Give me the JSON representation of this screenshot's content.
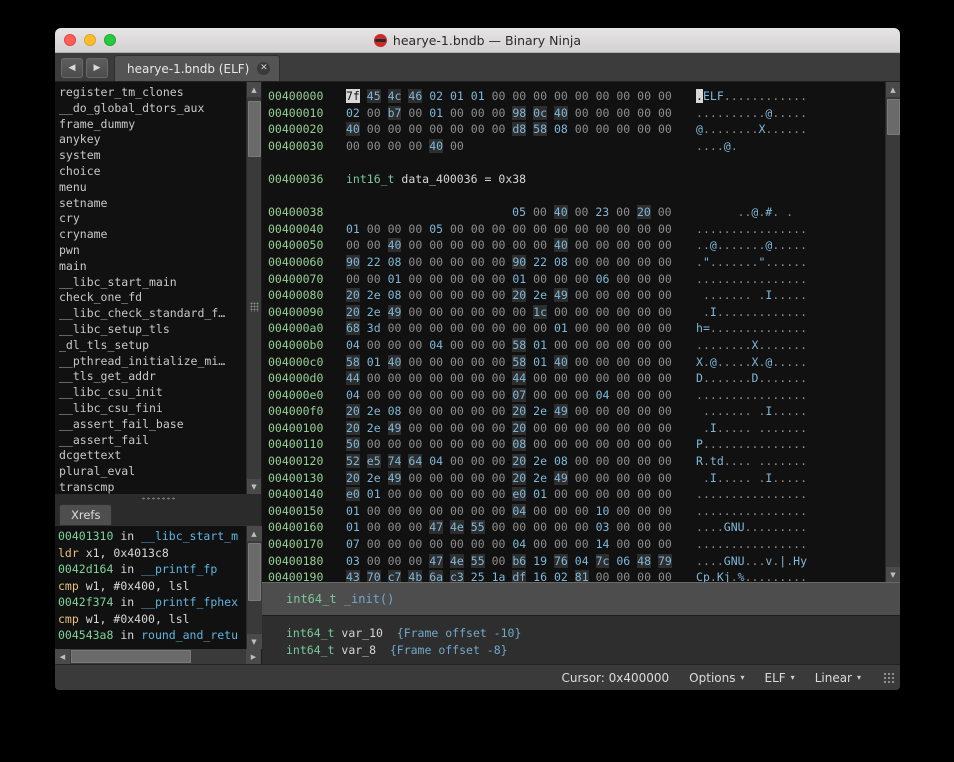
{
  "window": {
    "title": "hearye-1.bndb — Binary Ninja",
    "app_icon": "ninja-icon",
    "traffic": {
      "close": "close-button",
      "minimize": "minimize-button",
      "zoom": "zoom-button"
    }
  },
  "tabstrip": {
    "back_glyph": "◀",
    "forward_glyph": "▶",
    "tab_label": "hearye-1.bndb (ELF)",
    "close_glyph": "✕"
  },
  "sidebar": {
    "functions": [
      "register_tm_clones",
      "__do_global_dtors_aux",
      "frame_dummy",
      "anykey",
      "system",
      "choice",
      "menu",
      "setname",
      "cry",
      "cryname",
      "pwn",
      "main",
      "__libc_start_main",
      "check_one_fd",
      "__libc_check_standard_f…",
      "__libc_setup_tls",
      "_dl_tls_setup",
      "__pthread_initialize_mi…",
      "__tls_get_addr",
      "__libc_csu_init",
      "__libc_csu_fini",
      "__assert_fail_base",
      "__assert_fail",
      "dcgettext",
      "plural_eval",
      "transcmp"
    ]
  },
  "xrefs": {
    "tab_label": "Xrefs",
    "entries": [
      {
        "addr": "00401310",
        "in": "in",
        "func": "__libc_start_m",
        "mnem": "ldr",
        "ops": "x1, 0x4013c8"
      },
      {
        "addr": "0042d164",
        "in": "in",
        "func": "__printf_fp",
        "mnem": "cmp",
        "ops": "w1, #0x400, lsl"
      },
      {
        "addr": "0042f374",
        "in": "in",
        "func": "__printf_fphex",
        "mnem": "cmp",
        "ops": "w1, #0x400, lsl"
      },
      {
        "addr": "004543a8",
        "in": "in",
        "func": "round_and_retu",
        "mnem": "",
        "ops": ""
      }
    ]
  },
  "hex": {
    "rows": [
      {
        "addr": "00400000",
        "bytes": "7f 45 4c 46 02 01 01 00-00 00 00 00 00 00 00 00",
        "ascii": ".ELF............"
      },
      {
        "addr": "00400010",
        "bytes": "02 00 b7 00 01 00 00 00-98 0c 40 00 00 00 00 00",
        "ascii": "..........@....."
      },
      {
        "addr": "00400020",
        "bytes": "40 00 00 00 00 00 00 00-d8 58 08 00 00 00 00 00",
        "ascii": "@........X......"
      },
      {
        "addr": "00400030",
        "bytes": "00 00 00 00 40 00",
        "ascii": "....@."
      },
      {
        "addr": "",
        "bytes": "",
        "ascii": ""
      },
      {
        "addr": "00400036",
        "type": "int16_t data_400036 = 0x38"
      },
      {
        "addr": "",
        "bytes": "",
        "ascii": ""
      },
      {
        "addr": "00400038",
        "bytes": "                        05 00 40 00 23 00 20 00",
        "ascii": "      ..@.#. ."
      },
      {
        "addr": "00400040",
        "bytes": "01 00 00 00 05 00 00 00-00 00 00 00 00 00 00 00",
        "ascii": "................"
      },
      {
        "addr": "00400050",
        "bytes": "00 00 40 00 00 00 00 00-00 00 40 00 00 00 00 00",
        "ascii": "..@.......@....."
      },
      {
        "addr": "00400060",
        "bytes": "90 22 08 00 00 00 00 00-90 22 08 00 00 00 00 00",
        "ascii": ".\".......\"......"
      },
      {
        "addr": "00400070",
        "bytes": "00 00 01 00 00 00 00 00-01 00 00 00 06 00 00 00",
        "ascii": "................"
      },
      {
        "addr": "00400080",
        "bytes": "20 2e 08 00 00 00 00 00-20 2e 49 00 00 00 00 00",
        "ascii": " ....... .I....."
      },
      {
        "addr": "00400090",
        "bytes": "20 2e 49 00 00 00 00 00-00 1c 00 00 00 00 00 00",
        "ascii": " .I............."
      },
      {
        "addr": "004000a0",
        "bytes": "68 3d 00 00 00 00 00 00-00 00 01 00 00 00 00 00",
        "ascii": "h=.............."
      },
      {
        "addr": "004000b0",
        "bytes": "04 00 00 00 04 00 00 00-58 01 00 00 00 00 00 00",
        "ascii": "........X......."
      },
      {
        "addr": "004000c0",
        "bytes": "58 01 40 00 00 00 00 00-58 01 40 00 00 00 00 00",
        "ascii": "X.@.....X.@....."
      },
      {
        "addr": "004000d0",
        "bytes": "44 00 00 00 00 00 00 00-44 00 00 00 00 00 00 00",
        "ascii": "D.......D......."
      },
      {
        "addr": "004000e0",
        "bytes": "04 00 00 00 00 00 00 00-07 00 00 00 04 00 00 00",
        "ascii": "................"
      },
      {
        "addr": "004000f0",
        "bytes": "20 2e 08 00 00 00 00 00-20 2e 49 00 00 00 00 00",
        "ascii": " ....... .I....."
      },
      {
        "addr": "00400100",
        "bytes": "20 2e 49 00 00 00 00 00-20 00 00 00 00 00 00 00",
        "ascii": " .I..... ......."
      },
      {
        "addr": "00400110",
        "bytes": "50 00 00 00 00 00 00 00-08 00 00 00 00 00 00 00",
        "ascii": "P..............."
      },
      {
        "addr": "00400120",
        "bytes": "52 e5 74 64 04 00 00 00-20 2e 08 00 00 00 00 00",
        "ascii": "R.td.... ......."
      },
      {
        "addr": "00400130",
        "bytes": "20 2e 49 00 00 00 00 00-20 2e 49 00 00 00 00 00",
        "ascii": " .I..... .I....."
      },
      {
        "addr": "00400140",
        "bytes": "e0 01 00 00 00 00 00 00-e0 01 00 00 00 00 00 00",
        "ascii": "................"
      },
      {
        "addr": "00400150",
        "bytes": "01 00 00 00 00 00 00 00-04 00 00 00 10 00 00 00",
        "ascii": "................"
      },
      {
        "addr": "00400160",
        "bytes": "01 00 00 00 47 4e 55 00-00 00 00 00 03 00 00 00",
        "ascii": "....GNU........."
      },
      {
        "addr": "00400170",
        "bytes": "07 00 00 00 00 00 00 00-04 00 00 00 14 00 00 00",
        "ascii": "................"
      },
      {
        "addr": "00400180",
        "bytes": "03 00 00 00 47 4e 55 00-b6 19 76 04 7c 06 48 79",
        "ascii": "....GNU...v.|.Hy"
      },
      {
        "addr": "00400190",
        "bytes": "43 70 c7 4b 6a c3 25 1a-df 16 02 81 00 00 00 00",
        "ascii": "Cp.Kj.%........."
      }
    ]
  },
  "code": {
    "function_header": {
      "return_type": "int64_t",
      "name": "_init()"
    },
    "lines": [
      {
        "type": "int64_t",
        "name": "var_10",
        "comment": "{Frame offset -10}"
      },
      {
        "type": "int64_t",
        "name": "var_8",
        "comment": "{Frame offset -8}"
      }
    ]
  },
  "statusbar": {
    "cursor": "Cursor: 0x400000",
    "options": "Options",
    "format": "ELF",
    "view": "Linear",
    "caret": "▾"
  }
}
